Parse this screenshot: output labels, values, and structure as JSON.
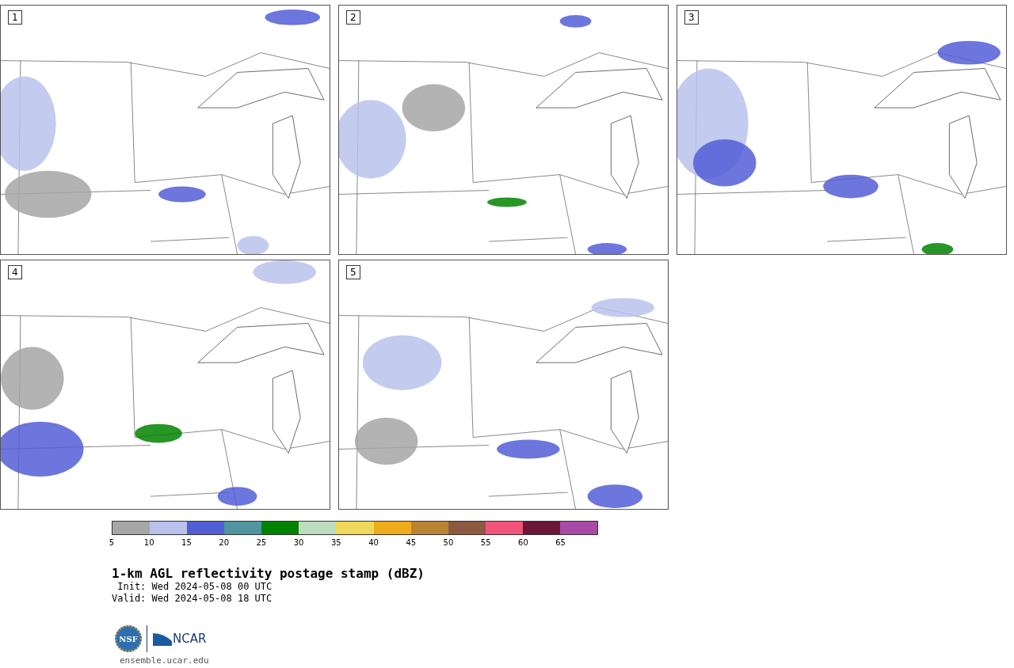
{
  "panels": [
    {
      "label": "1"
    },
    {
      "label": "2"
    },
    {
      "label": "3"
    },
    {
      "label": "4"
    },
    {
      "label": "5"
    }
  ],
  "colorbar": {
    "segments": [
      {
        "color": "#a6a6a6"
      },
      {
        "color": "#b8c2ec"
      },
      {
        "color": "#525ed6"
      },
      {
        "color": "#4f96a0"
      },
      {
        "color": "#008400"
      },
      {
        "color": "#bedcc0"
      },
      {
        "color": "#efd95c"
      },
      {
        "color": "#edae1a"
      },
      {
        "color": "#bb8434"
      },
      {
        "color": "#8b5a40"
      },
      {
        "color": "#f2547a"
      },
      {
        "color": "#6a1738"
      },
      {
        "color": "#a84aa6"
      }
    ],
    "ticks": [
      "5",
      "10",
      "15",
      "20",
      "25",
      "30",
      "35",
      "40",
      "45",
      "50",
      "55",
      "60",
      "65"
    ]
  },
  "title": "1-km AGL reflectivity postage stamp (dBZ)",
  "init": " Init: Wed 2024-05-08 00 UTC",
  "valid": "Valid: Wed 2024-05-08 18 UTC",
  "logo": {
    "left": "NSF",
    "right": "NCAR"
  },
  "footer": "ensemble.ucar.edu"
}
